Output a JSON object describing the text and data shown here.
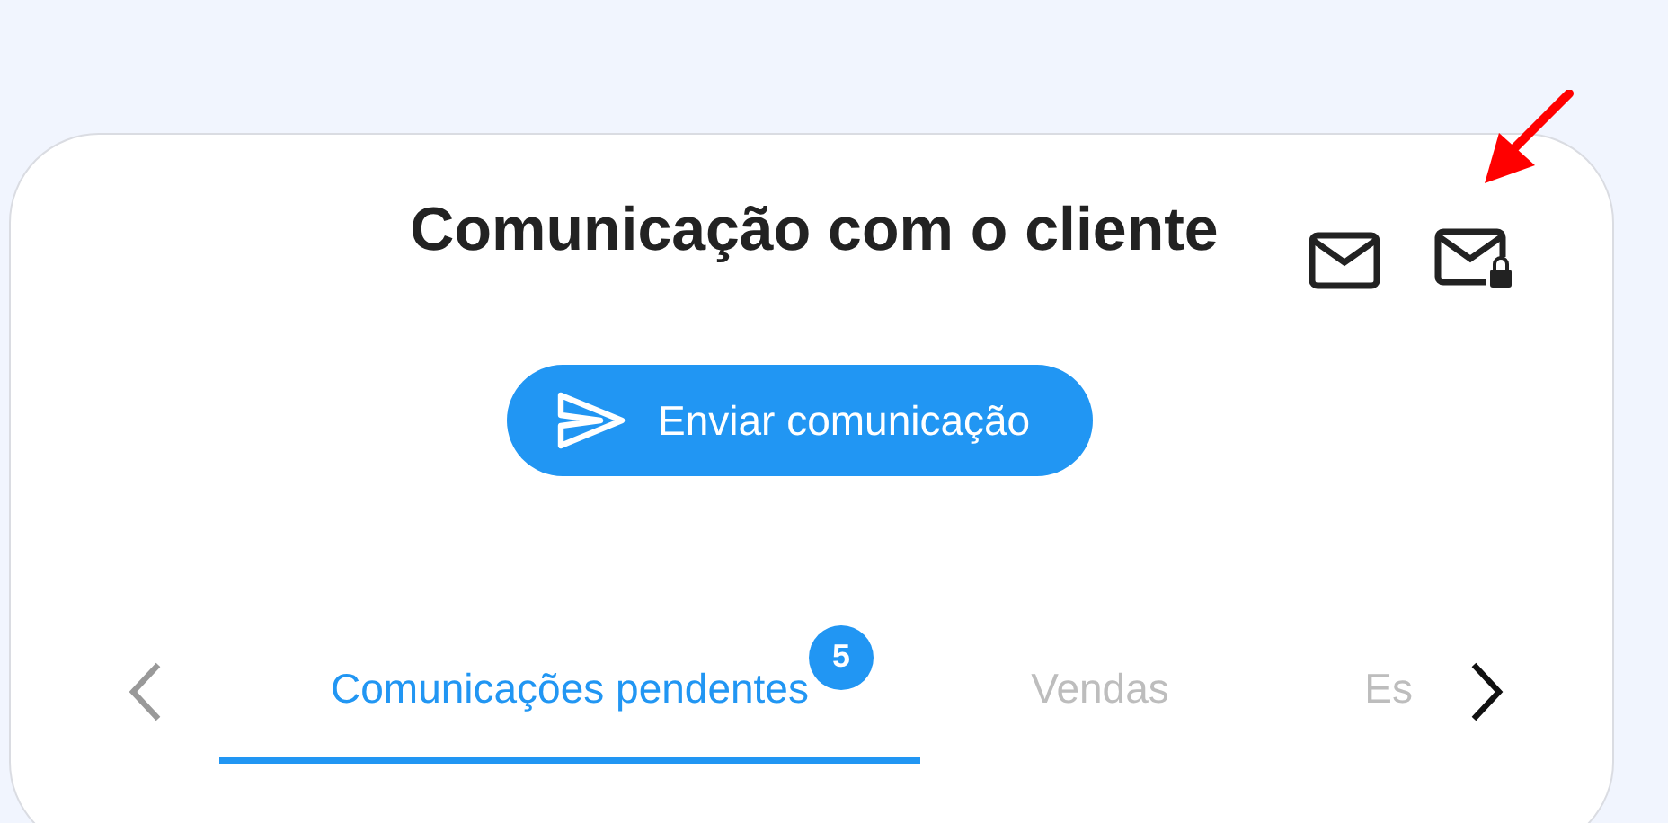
{
  "title": "Comunicação com o cliente",
  "header_icons": [
    {
      "kind": "mail"
    },
    {
      "kind": "mail-lock"
    }
  ],
  "send_button": {
    "label": "Enviar comunicação"
  },
  "tabs_nav": {
    "prev_disabled": true,
    "next_disabled": false
  },
  "tabs": [
    {
      "label": "Comunicações pendentes",
      "selected": true,
      "badge": "5"
    },
    {
      "label": "Vendas",
      "selected": false
    },
    {
      "label": "Es",
      "selected": false
    }
  ],
  "annotation": {
    "kind": "arrow"
  }
}
